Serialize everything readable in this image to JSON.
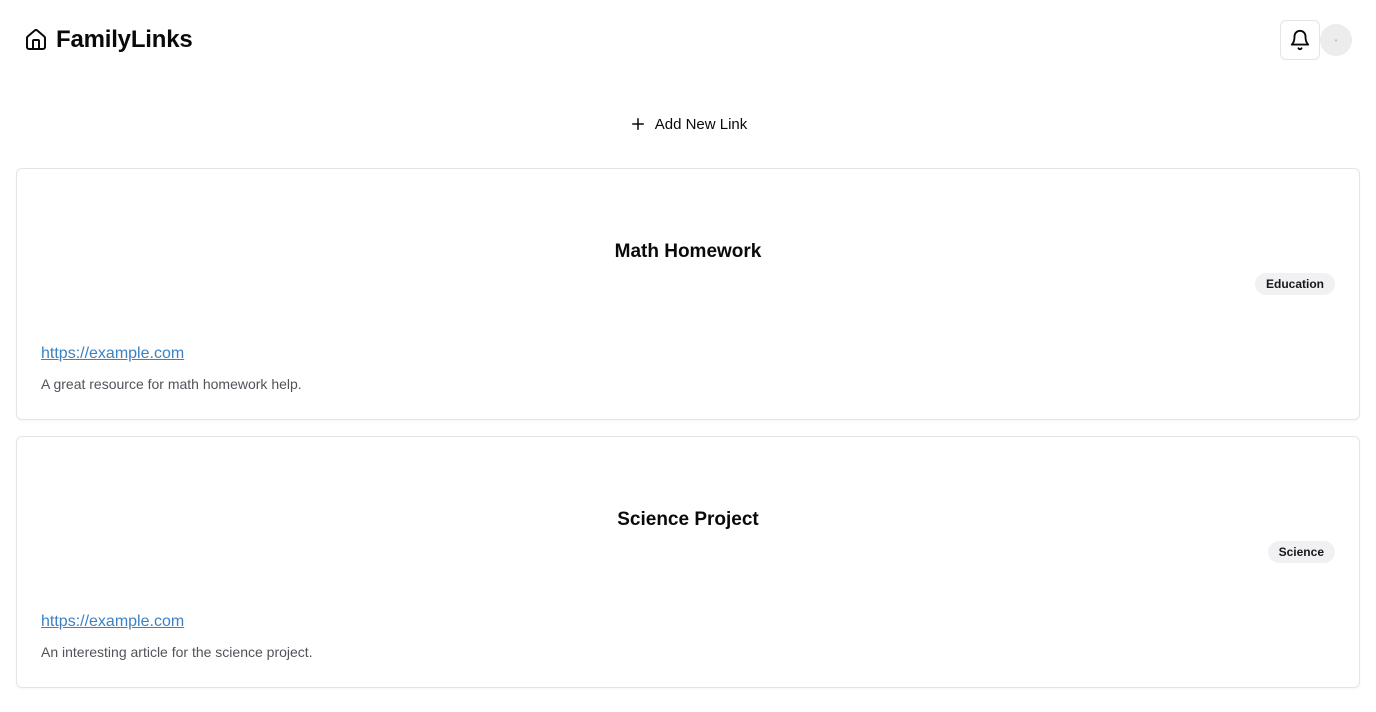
{
  "app": {
    "title": "FamilyLinks",
    "home_icon": "home-icon",
    "notifications_icon": "bell-icon",
    "avatar_text": "•"
  },
  "toolbar": {
    "add_link_label": "Add New Link",
    "add_link_icon": "plus-icon"
  },
  "links": [
    {
      "title": "Math Homework",
      "category": "Education",
      "url": "https://example.com",
      "description": "A great resource for math homework help."
    },
    {
      "title": "Science Project",
      "category": "Science",
      "url": "https://example.com",
      "description": "An interesting article for the science project."
    }
  ],
  "colors": {
    "link": "#3b82c4",
    "badge_bg": "#f1f1f3",
    "border": "#e4e4e7",
    "text_muted": "#52525b"
  }
}
